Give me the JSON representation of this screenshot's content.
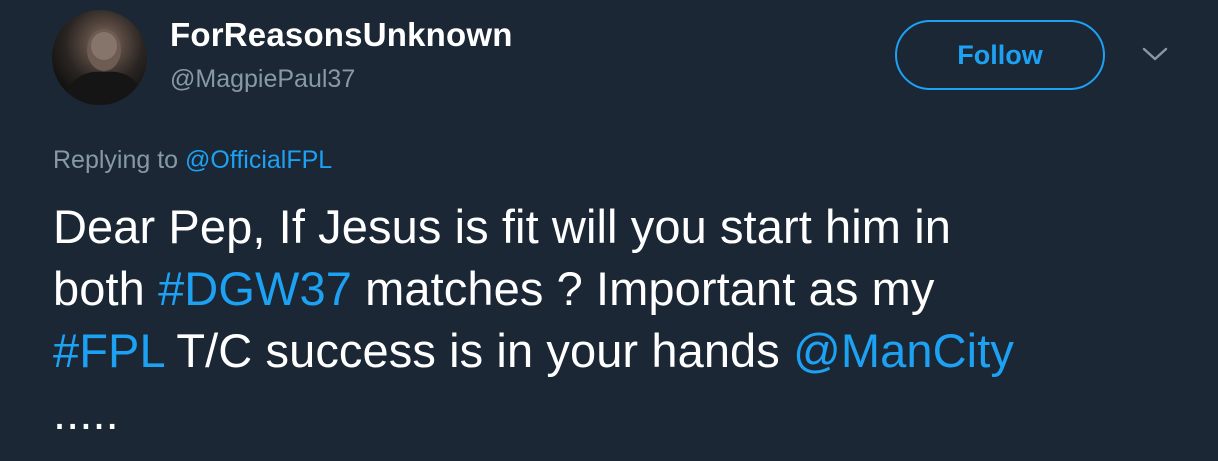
{
  "user": {
    "display_name": "ForReasonsUnknown",
    "handle": "@MagpiePaul37"
  },
  "actions": {
    "follow_label": "Follow",
    "menu_icon": "chevron-down-icon"
  },
  "reply": {
    "prefix": "Replying to",
    "mention": "@OfficialFPL"
  },
  "tweet": {
    "line1": "Dear Pep, If Jesus is fit will you start him in",
    "line2_a": "both",
    "line2_tag": "#DGW37",
    "line2_b": "matches ? Important as my",
    "line3_tag": "#FPL",
    "line3_a": "T/C success is in your hands",
    "line3_mention": "@ManCity",
    "line4": "....."
  },
  "colors": {
    "background": "#1b2735",
    "accent": "#1da1f2",
    "muted": "#8899a6",
    "text": "#ffffff"
  }
}
